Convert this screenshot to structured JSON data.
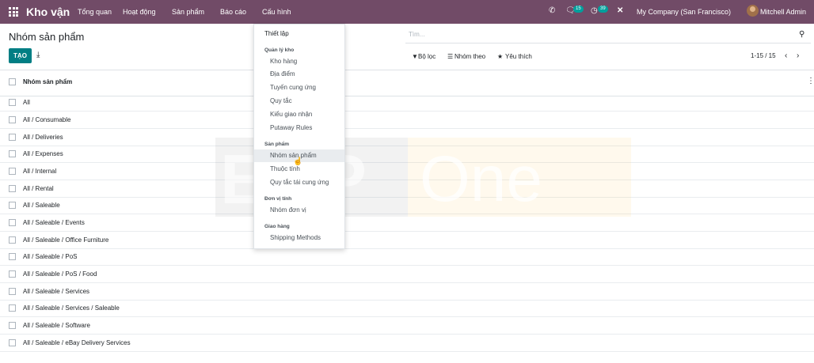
{
  "topbar": {
    "app_name": "Kho vận",
    "menu": [
      "Tổng quan",
      "Hoạt động",
      "Sản phẩm",
      "Báo cáo",
      "Cấu hình"
    ],
    "chat_count": "15",
    "activity_count": "39",
    "company": "My Company (San Francisco)",
    "user": "Mitchell Admin"
  },
  "control": {
    "title": "Nhóm sản phẩm",
    "search_placeholder": "Tìm...",
    "create_label": "TẠO",
    "filters_label": "Bộ lọc",
    "group_by_label": "Nhóm theo",
    "favorites_label": "Yêu thích",
    "pager": "1-15 / 15"
  },
  "table": {
    "column": "Nhóm sản phẩm",
    "rows": [
      "All",
      "All / Consumable",
      "All / Deliveries",
      "All / Expenses",
      "All / Internal",
      "All / Rental",
      "All / Saleable",
      "All / Saleable / Events",
      "All / Saleable / Office Furniture",
      "All / Saleable / PoS",
      "All / Saleable / PoS / Food",
      "All / Saleable / Services",
      "All / Saleable / Services / Saleable",
      "All / Saleable / Software",
      "All / Saleable / eBay Delivery Services"
    ]
  },
  "dropdown": {
    "settings": "Thiết lập",
    "sections": [
      {
        "header": "Quản lý kho",
        "items": [
          "Kho hàng",
          "Địa điểm",
          "Tuyến cung ứng",
          "Quy tắc",
          "Kiểu giao nhận",
          "Putaway Rules"
        ]
      },
      {
        "header": "Sản phẩm",
        "items": [
          "Nhóm sản phẩm",
          "Thuộc tính",
          "Quy tắc tái cung ứng"
        ]
      },
      {
        "header": "Đơn vị tính",
        "items": [
          "Nhóm đơn vị"
        ]
      },
      {
        "header": "Giao hàng",
        "items": [
          "Shipping Methods"
        ]
      }
    ]
  },
  "watermark": {
    "left": "ERP",
    "right": "One"
  },
  "colors": {
    "topbar": "#714b67",
    "primary": "#017e84",
    "badge": "#00a09d"
  }
}
